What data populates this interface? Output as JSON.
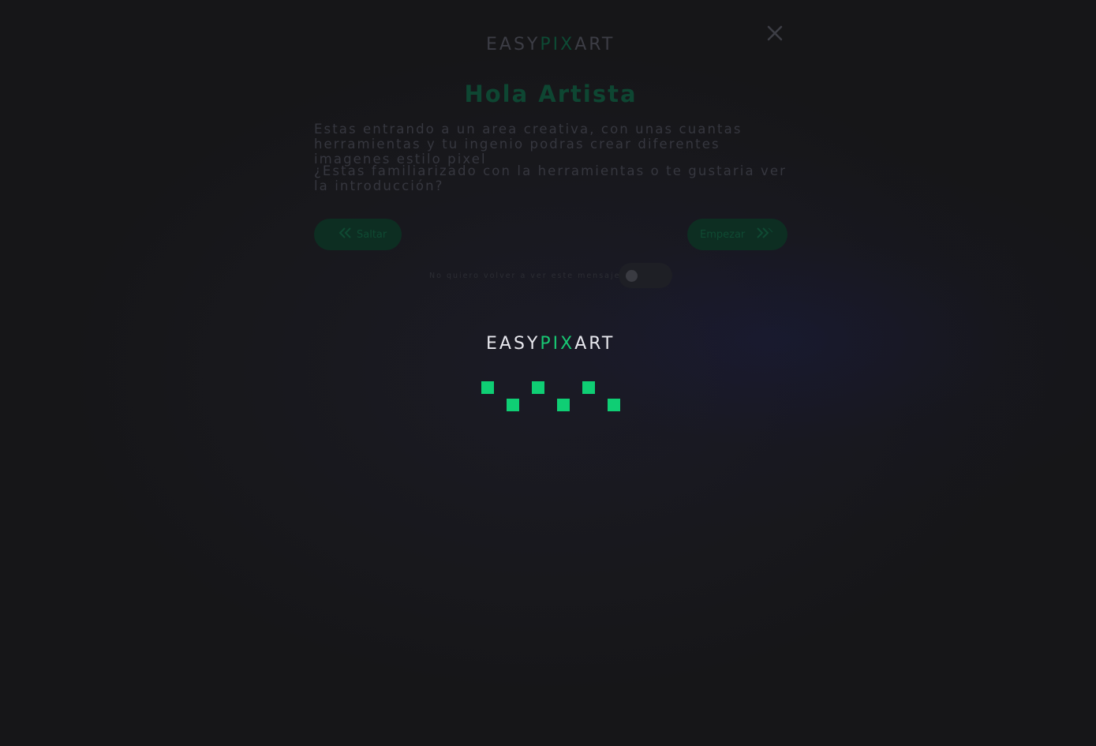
{
  "dialog": {
    "logo": {
      "part1": "EASY",
      "part2": "PIX",
      "part3": "ART"
    },
    "close_icon": "close-icon",
    "title": "Hola Artista",
    "paragraph_1": "Estas entrando a un area creativa, con unas cuantas herramientas y tu ingenio podras crear diferentes imagenes estilo pixel",
    "paragraph_2": "¿Estas familiarizado con la herramientas o te gustaria ver la introducción?",
    "skip_button": {
      "label": "Saltar",
      "icon": "double-chevron-left-icon"
    },
    "start_button": {
      "label": "Empezar",
      "icon": "double-chevron-right-icon"
    },
    "toggle": {
      "label": "No quiero volver a ver este mensaje",
      "checked": false
    }
  },
  "loader": {
    "logo": {
      "part1": "EASY",
      "part2": "PIX",
      "part3": "ART"
    },
    "dot_count": 6
  },
  "colors": {
    "accent": "#0fce74",
    "background": "#161618",
    "logo_text": "#e8e8ee"
  }
}
